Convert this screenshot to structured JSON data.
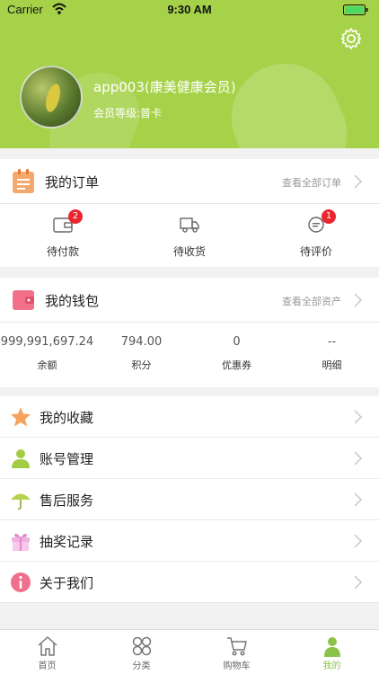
{
  "status_bar": {
    "carrier": "Carrier",
    "time": "9:30 AM"
  },
  "profile": {
    "name": "app003(康美健康会员)",
    "level": "会员等级:普卡"
  },
  "orders": {
    "title": "我的订单",
    "more": "查看全部订单",
    "items": [
      {
        "label": "待付款",
        "badge": "2"
      },
      {
        "label": "待收货",
        "badge": ""
      },
      {
        "label": "待评价",
        "badge": "1"
      }
    ]
  },
  "wallet": {
    "title": "我的钱包",
    "more": "查看全部资产",
    "items": [
      {
        "value": "999,991,697.24",
        "label": "余额"
      },
      {
        "value": "794.00",
        "label": "积分"
      },
      {
        "value": "0",
        "label": "优惠券"
      },
      {
        "value": "--",
        "label": "明细"
      }
    ]
  },
  "menu": [
    {
      "label": "我的收藏"
    },
    {
      "label": "账号管理"
    },
    {
      "label": "售后服务"
    },
    {
      "label": "抽奖记录"
    },
    {
      "label": "关于我们"
    }
  ],
  "tabbar": [
    {
      "label": "首页"
    },
    {
      "label": "分类"
    },
    {
      "label": "购物车"
    },
    {
      "label": "我的"
    }
  ],
  "colors": {
    "accent": "#8bc34a",
    "header_bg": "#a6d24a",
    "badge": "#e8262b"
  }
}
